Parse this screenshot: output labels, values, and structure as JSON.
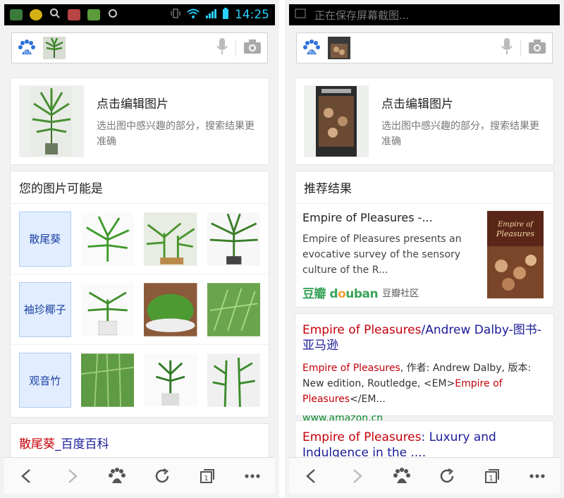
{
  "left": {
    "status": {
      "time": "14:25"
    },
    "search": {
      "mic_icon": "microphone-icon",
      "camera_icon": "camera-icon"
    },
    "edit_card": {
      "title": "点击编辑图片",
      "subtitle": "选出图中感兴趣的部分，搜索结果更准确"
    },
    "maybe": {
      "title": "您的图片可能是",
      "rows": [
        {
          "label": "散尾葵"
        },
        {
          "label": "袖珍椰子"
        },
        {
          "label": "观音竹"
        }
      ]
    },
    "wiki": {
      "title_red": "散尾葵",
      "title_blue": "_百度百科"
    }
  },
  "right": {
    "status": {
      "notification": "正在保存屏幕截图..."
    },
    "edit_card": {
      "title": "点击编辑图片",
      "subtitle": "选出图中感兴趣的部分，搜索结果更准确"
    },
    "recommend": {
      "title": "推荐结果",
      "item_title": "Empire of Pleasures -...",
      "item_snippet": "Empire of Pleasures presents an evocative survey of the sensory culture of the R...",
      "source_logo": "douban",
      "source_name": "豆瓣社区",
      "cover_title": "Empire of Pleasures"
    },
    "result1": {
      "title_hl": "Empire of Pleasures",
      "title_rest": "/Andrew Dalby-图书-亚马逊",
      "snippet_hl1": "Empire of Pleasures",
      "snippet_mid": ", 作者: Andrew Dalby, 版本: New edition, Routledge, <EM>",
      "snippet_hl2": "Empire of Pleasures",
      "snippet_end": "</EM...",
      "url": "www.amazon.cn"
    },
    "result2": {
      "title_hl": "Empire of Pleasures",
      "title_rest": ": Luxury and Indulgence in the ...."
    }
  },
  "bottombar": {
    "icons": [
      "back-icon",
      "forward-icon",
      "baidu-paw-icon",
      "refresh-icon",
      "tabs-icon",
      "more-icon"
    ],
    "tab_count": "1"
  }
}
